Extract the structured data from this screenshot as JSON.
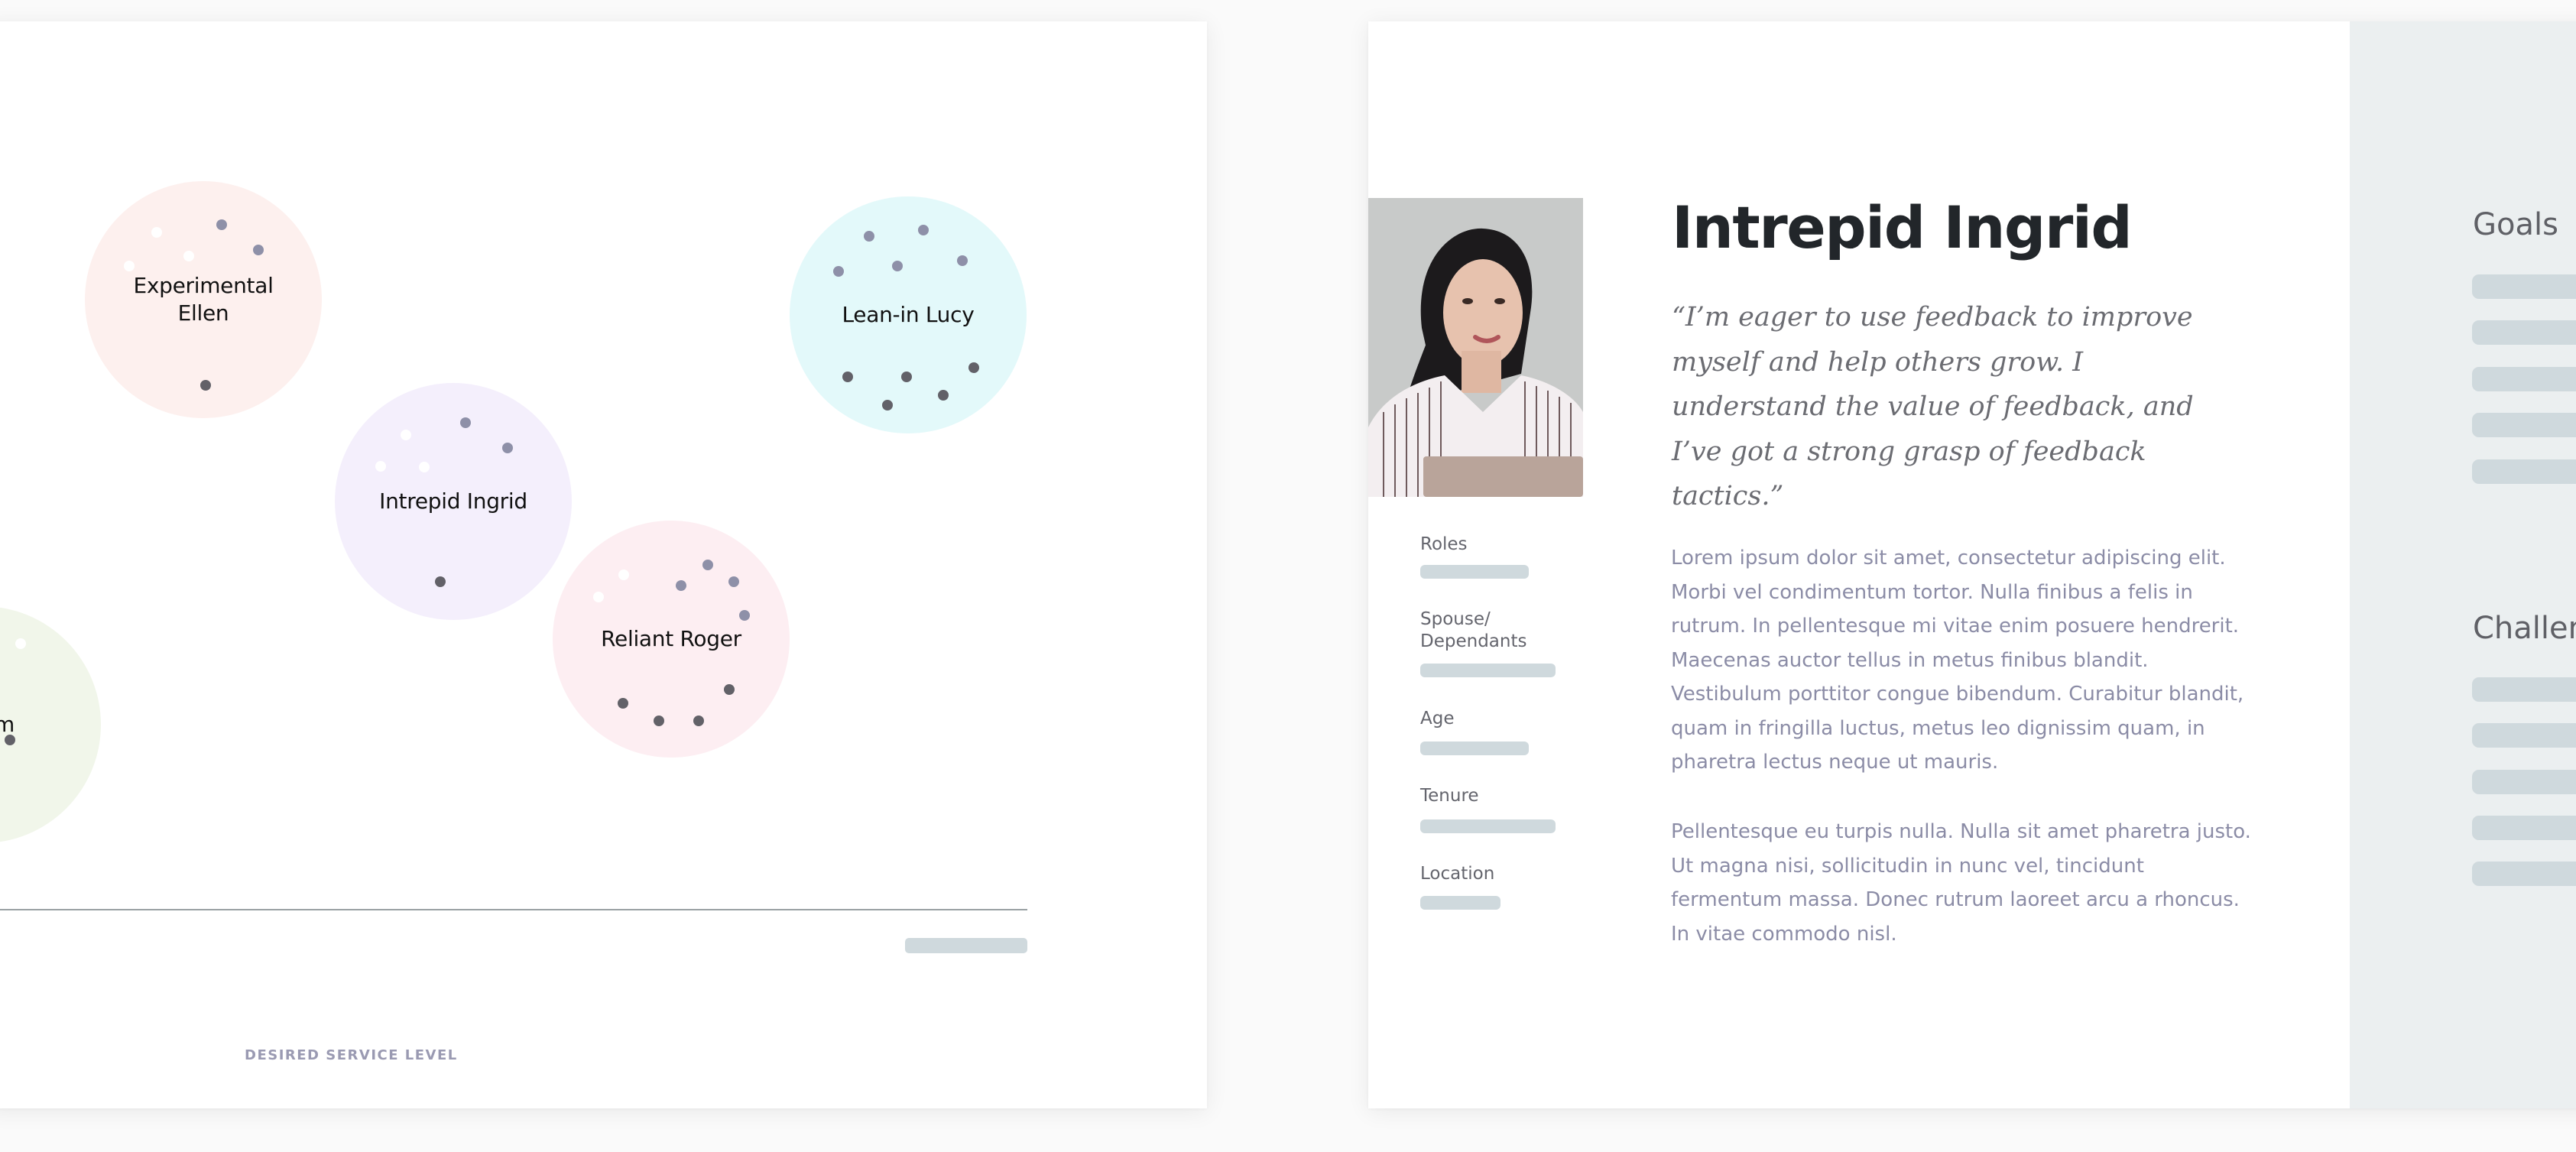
{
  "persona_map": {
    "axis_label": "DESIRED SERVICE LEVEL",
    "personas": [
      {
        "name": "Experimental Ellen",
        "color": "#fdf0ee",
        "dots": {
          "light": 3,
          "medium": 2,
          "dark": 1
        }
      },
      {
        "name": "Lean-in Lucy",
        "color": "#e3f9fa",
        "dots": {
          "light": 0,
          "medium": 5,
          "dark": 5
        }
      },
      {
        "name": "Intrepid Ingrid",
        "color": "#f4effc",
        "dots": {
          "light": 3,
          "medium": 2,
          "dark": 1
        }
      },
      {
        "name": "Reliant Roger",
        "color": "#fdeef2",
        "dots": {
          "light": 2,
          "medium": 4,
          "dark": 4
        }
      },
      {
        "name": "Tom",
        "color": "#f1f6ea",
        "dots": {
          "light": 1,
          "medium": 0,
          "dark": 1
        }
      }
    ],
    "dot_colors": {
      "light": "#ffffff",
      "medium": "#8e90a8",
      "dark": "#626168"
    }
  },
  "persona_card": {
    "title": "Intrepid Ingrid",
    "photo_alt": "Portrait of Intrepid Ingrid",
    "quote": "“I’m eager to use feedback to improve myself and help others grow. I understand the value of feedback, and I’ve got a strong grasp of feedback tactics.”",
    "attributes": [
      {
        "label": "Roles"
      },
      {
        "label": "Spouse/\nDependants"
      },
      {
        "label": "Age"
      },
      {
        "label": "Tenure"
      },
      {
        "label": "Location"
      }
    ],
    "body": [
      "Lorem ipsum dolor sit amet, consectetur adipiscing elit. Morbi vel condimentum tortor. Nulla finibus a felis in rutrum. In pellentesque mi vitae enim posuere hendrerit. Maecenas auctor tellus in metus finibus blandit. Vestibulum porttitor congue bibendum. Curabitur blandit, quam in fringilla luctus, metus leo dignissim quam, in pharetra lectus neque ut mauris.",
      "Pellentesque eu turpis nulla. Nulla sit amet pharetra justo. Ut magna nisi, sollicitudin in nunc vel, tincidunt fermentum massa. Donec rutrum laoreet arcu a rhoncus. In vitae commodo nisl."
    ],
    "side_sections": [
      {
        "heading": "Goals",
        "placeholder_lines": 5
      },
      {
        "heading": "Challenges",
        "placeholder_lines": 5
      }
    ]
  },
  "colors": {
    "placeholder": "#cfd9dd",
    "side_panel": "#ebeff0",
    "title": "#22262a",
    "body_text": "#8b8ca6"
  }
}
